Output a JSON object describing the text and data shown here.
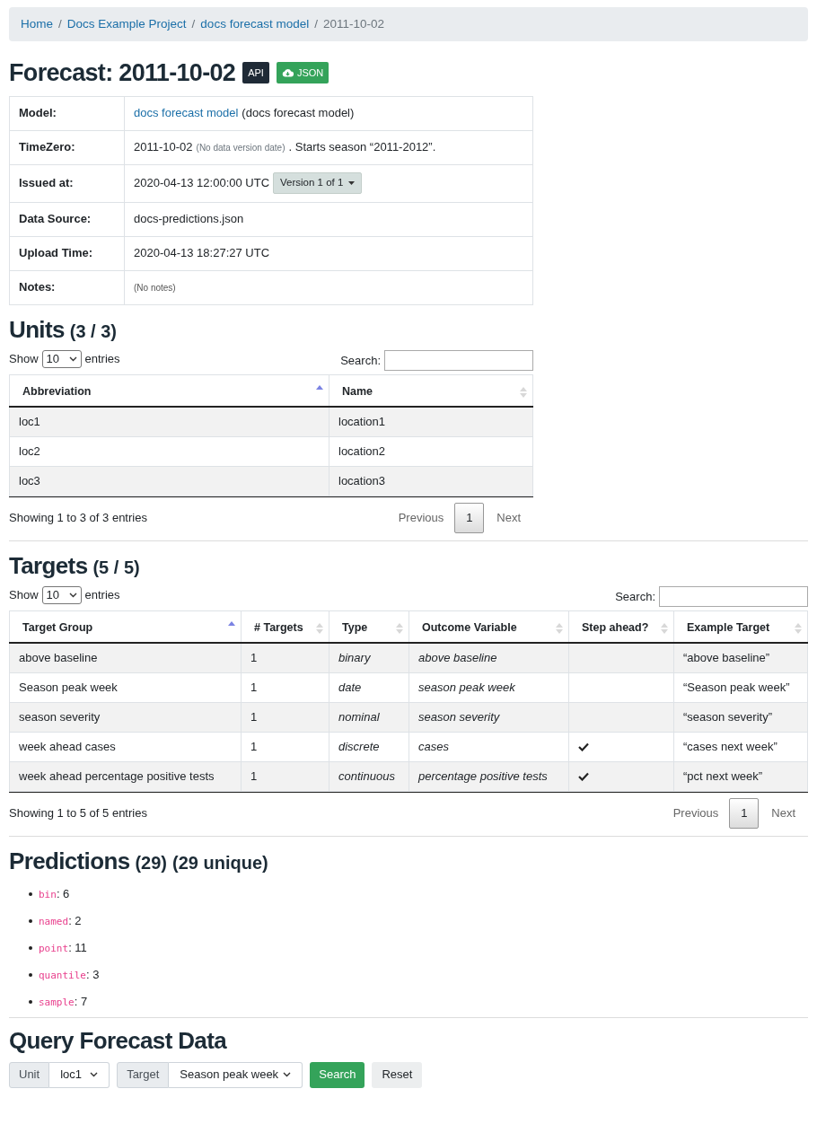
{
  "breadcrumb": [
    {
      "label": "Home",
      "link": true
    },
    {
      "separator": "/",
      "label": "Docs Example Project",
      "link": true
    },
    {
      "separator": "/",
      "label": "docs forecast model",
      "link": true
    },
    {
      "separator": "/",
      "label": "2011-10-02",
      "link": false
    }
  ],
  "title": "Forecast: 2011-10-02",
  "badges": [
    {
      "label": "API",
      "kind": "dark"
    },
    {
      "label": "JSON",
      "kind": "download"
    }
  ],
  "details": [
    {
      "label": "Model:",
      "kind": "link",
      "link": "docs forecast model",
      "text": "(docs forecast model)"
    },
    {
      "label": "TimeZero:",
      "kind": "note",
      "text": "2011-10-02",
      "note": "(No data version date)",
      "suffix": ". Starts season “2011-2012”."
    },
    {
      "label": "Issued at:",
      "kind": "version",
      "text": "2020-04-13 12:00:00 UTC",
      "button": "Version 1 of 1"
    },
    {
      "label": "Data Source:",
      "kind": "text",
      "text": "docs-predictions.json"
    },
    {
      "label": "Upload Time:",
      "kind": "text",
      "text": "2020-04-13 18:27:27 UTC"
    },
    {
      "label": "Notes:",
      "kind": "muted",
      "text": "(No notes)"
    }
  ],
  "units": {
    "title": "Units",
    "count": "(3 / 3)",
    "show_label": "Show",
    "page_size": "10",
    "entries_label": "entries",
    "search_label": "Search:",
    "columns": [
      {
        "label": "Abbreviation",
        "sorted": true
      },
      {
        "label": "Name",
        "sorted": false
      }
    ],
    "rows": [
      [
        "loc1",
        "location1"
      ],
      [
        "loc2",
        "location2"
      ],
      [
        "loc3",
        "location3"
      ]
    ],
    "info": "Showing 1 to 3 of 3 entries",
    "previous": "Previous",
    "pages": [
      {
        "label": "1",
        "selected": true
      }
    ],
    "next": "Next"
  },
  "targets": {
    "title": "Targets",
    "count": "(5 / 5)",
    "show_label": "Show",
    "page_size": "10",
    "entries_label": "entries",
    "search_label": "Search:",
    "columns": [
      {
        "label": "Target Group",
        "sorted": true,
        "kind": "text"
      },
      {
        "label": "# Targets",
        "sorted": false,
        "kind": "text"
      },
      {
        "label": "Type",
        "sorted": false,
        "kind": "italic"
      },
      {
        "label": "Outcome Variable",
        "sorted": false,
        "kind": "italic"
      },
      {
        "label": "Step ahead?",
        "sorted": false,
        "kind": "check"
      },
      {
        "label": "Example Target",
        "sorted": false,
        "kind": "text"
      }
    ],
    "rows": [
      [
        "above baseline",
        "1",
        "binary",
        "above baseline",
        false,
        "“above baseline”"
      ],
      [
        "Season peak week",
        "1",
        "date",
        "season peak week",
        false,
        "“Season peak week”"
      ],
      [
        "season severity",
        "1",
        "nominal",
        "season severity",
        false,
        "“season severity”"
      ],
      [
        "week ahead cases",
        "1",
        "discrete",
        "cases",
        true,
        "“cases next week”"
      ],
      [
        "week ahead percentage positive tests",
        "1",
        "continuous",
        "percentage positive tests",
        true,
        "“pct next week”"
      ]
    ],
    "info": "Showing 1 to 5 of 5 entries",
    "previous": "Previous",
    "pages": [
      {
        "label": "1",
        "selected": true
      }
    ],
    "next": "Next"
  },
  "predictions": {
    "title": "Predictions",
    "count": "(29)",
    "unique": "(29 unique)",
    "items": [
      {
        "type": "bin",
        "rest": ": 6"
      },
      {
        "type": "named",
        "rest": ": 2"
      },
      {
        "type": "point",
        "rest": ": 11"
      },
      {
        "type": "quantile",
        "rest": ": 3"
      },
      {
        "type": "sample",
        "rest": ": 7"
      }
    ]
  },
  "query": {
    "title": "Query Forecast Data",
    "unit_label": "Unit",
    "unit_value": "loc1",
    "target_label": "Target",
    "target_value": "Season peak week",
    "search_button": "Search",
    "reset_button": "Reset"
  }
}
